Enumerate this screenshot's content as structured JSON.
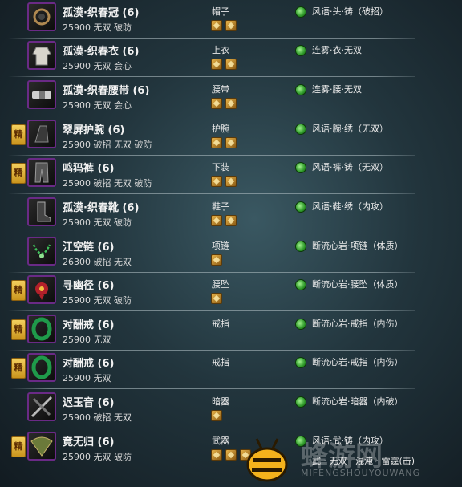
{
  "colors": {
    "refine_badge": "#e0b236",
    "icon_border": "#6a2a86",
    "enchant_icon": "#3db336",
    "gem": "#d9a23c"
  },
  "items": [
    {
      "refine": "",
      "name": "孤漠·织春冠 (6)",
      "stats": "25900 无双 破防",
      "slot": "帽子",
      "gems": 2,
      "enchant": "风语·头·铸（破招）",
      "icon": "helmet-icon"
    },
    {
      "refine": "",
      "name": "孤漠·织春衣 (6)",
      "stats": "25900 无双 会心",
      "slot": "上衣",
      "gems": 2,
      "enchant": "连雾·衣·无双",
      "icon": "robe-icon"
    },
    {
      "refine": "",
      "name": "孤漠·织春腰带 (6)",
      "stats": "25900 无双 会心",
      "slot": "腰带",
      "gems": 2,
      "enchant": "连雾·腰·无双",
      "icon": "belt-icon"
    },
    {
      "refine": "精",
      "name": "翠屏护腕 (6)",
      "stats": "25900 破招 无双 破防",
      "slot": "护腕",
      "gems": 2,
      "enchant": "风语·腕·绣（无双）",
      "icon": "bracer-icon"
    },
    {
      "refine": "精",
      "name": "鸣犸裤 (6)",
      "stats": "25900 破招 无双 破防",
      "slot": "下装",
      "gems": 2,
      "enchant": "风语·裤·铸（无双）",
      "icon": "pants-icon"
    },
    {
      "refine": "",
      "name": "孤漠·织春靴 (6)",
      "stats": "25900 无双 破防",
      "slot": "鞋子",
      "gems": 2,
      "enchant": "风语·鞋·绣（内攻）",
      "icon": "boots-icon"
    },
    {
      "refine": "",
      "name": "江空链 (6)",
      "stats": "26300 破招 无双",
      "slot": "项链",
      "gems": 1,
      "enchant": "断流心岩·项链（体质）",
      "icon": "necklace-icon"
    },
    {
      "refine": "精",
      "name": "寻幽径 (6)",
      "stats": "25900 无双 破防",
      "slot": "腰坠",
      "gems": 1,
      "enchant": "断流心岩·腰坠（体质）",
      "icon": "pendant-icon"
    },
    {
      "refine": "精",
      "name": "对酬戒 (6)",
      "stats": "25900 无双",
      "slot": "戒指",
      "gems": 0,
      "enchant": "断流心岩·戒指（内伤）",
      "icon": "ring-icon"
    },
    {
      "refine": "精",
      "name": "对酬戒 (6)",
      "stats": "25900 无双",
      "slot": "戒指",
      "gems": 0,
      "enchant": "断流心岩·戒指（内伤）",
      "icon": "ring-icon"
    },
    {
      "refine": "",
      "name": "迟玉音 (6)",
      "stats": "25900 破招 无双",
      "slot": "暗器",
      "gems": 1,
      "enchant": "断流心岩·暗器（内破）",
      "icon": "hidden-weapon-icon"
    },
    {
      "refine": "精",
      "name": "竟无归 (6)",
      "stats": "25900 无双 破防",
      "slot": "武器",
      "gems": 3,
      "enchant": "风语·武·铸（内攻）",
      "icon": "fan-weapon-icon"
    }
  ],
  "overlay_text": "武 · 无双 · 混沌 · 雷霆(击)",
  "watermark": {
    "title": "蜂游网",
    "subtitle": "MIFENGSHOUYOUWANG"
  }
}
